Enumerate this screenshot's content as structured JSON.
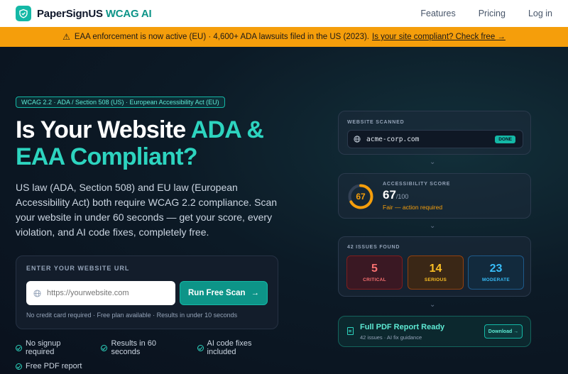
{
  "nav": {
    "brand": "PaperSignUS",
    "brand_accent": "WCAG AI",
    "links": [
      "Features",
      "Pricing",
      "Log in"
    ]
  },
  "banner": {
    "icon": "warning-triangle-icon",
    "text": "EAA enforcement is now active (EU) · 4,600+ ADA lawsuits filed in the US (2023).",
    "link": "Is your site compliant? Check free →"
  },
  "hero": {
    "tag": "WCAG 2.2 · ADA / Section 508 (US) · European Accessibility Act (EU)",
    "title_part1": "Is Your Website ",
    "title_accent1": "ADA &",
    "title_accent2": "EAA Compliant?",
    "lead": "US law (ADA, Section 508) and EU law (European Accessibility Act) both require WCAG 2.2 compliance. Scan your website in under 60 seconds — get your score, every violation, and AI code fixes, completely free."
  },
  "scan_form": {
    "label": "ENTER YOUR WEBSITE URL",
    "placeholder": "https://yourwebsite.com",
    "button": "Run Free Scan",
    "fine_print": "No credit card required · Free plan available · Results in under 10 seconds"
  },
  "checks": [
    "No signup required",
    "Results in 60 seconds",
    "AI code fixes included",
    "Free PDF report"
  ],
  "preview": {
    "scanned": {
      "label": "WEBSITE SCANNED",
      "site": "acme-corp.com",
      "status": "DONE"
    },
    "score": {
      "label": "ACCESSIBILITY SCORE",
      "value": "67",
      "max": "/100",
      "status": "Fair — action required",
      "gauge_fraction": 0.67
    },
    "issues": {
      "label": "42 ISSUES FOUND",
      "critical": "5",
      "critical_label": "CRITICAL",
      "serious": "14",
      "serious_label": "SERIOUS",
      "moderate": "23",
      "moderate_label": "MODERATE"
    },
    "report": {
      "title": "Full PDF Report Ready",
      "sub": "42 issues · AI fix guidance",
      "button": "Download →"
    }
  },
  "colors": {
    "accent": "#14b8a6",
    "warning": "#f59e0b",
    "critical": "#f87171",
    "serious": "#fbbf24",
    "moderate": "#38bdf8"
  }
}
